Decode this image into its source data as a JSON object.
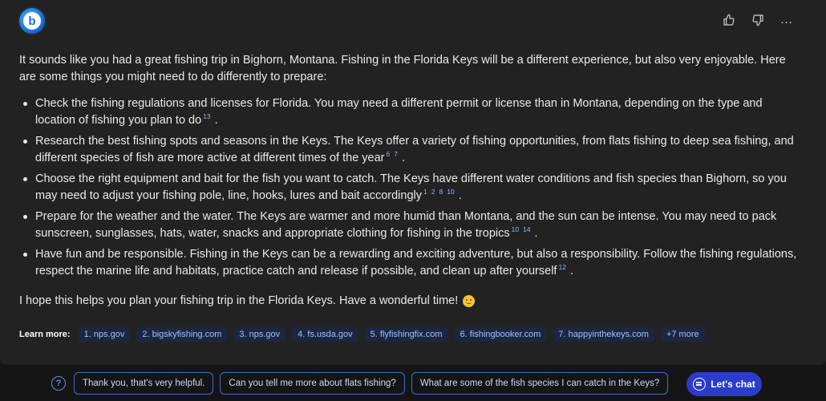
{
  "header": {
    "logo_letter": "b",
    "actions": [
      "thumbs-up-icon",
      "thumbs-down-icon",
      "more-icon"
    ],
    "more_label": "…"
  },
  "message": {
    "intro": "It sounds like you had a great fishing trip in Bighorn, Montana. Fishing in the Florida Keys will be a different experience, but also very enjoyable. Here are some things you might need to do differently to prepare:",
    "points": [
      {
        "text": "Check the fishing regulations and licenses for Florida. You may need a different permit or license than in Montana, depending on the type and location of fishing you plan to do",
        "citations": [
          "13"
        ]
      },
      {
        "text": "Research the best fishing spots and seasons in the Keys. The Keys offer a variety of fishing opportunities, from flats fishing to deep sea fishing, and different species of fish are more active at different times of the year",
        "citations": [
          "6",
          "7"
        ]
      },
      {
        "text": "Choose the right equipment and bait for the fish you want to catch. The Keys have different water conditions and fish species than Bighorn, so you may need to adjust your fishing pole, line, hooks, lures and bait accordingly",
        "citations": [
          "1",
          "2",
          "8",
          "10"
        ]
      },
      {
        "text": "Prepare for the weather and the water. The Keys are warmer and more humid than Montana, and the sun can be intense. You may need to pack sunscreen, sunglasses, hats, water, snacks and appropriate clothing for fishing in the tropics",
        "citations": [
          "10",
          "14"
        ]
      },
      {
        "text": "Have fun and be responsible. Fishing in the Keys can be a rewarding and exciting adventure, but also a responsibility. Follow the fishing regulations, respect the marine life and habitats, practice catch and release if possible, and clean up after yourself",
        "citations": [
          "12"
        ]
      }
    ],
    "outro": "I hope this helps you plan your fishing trip in the Florida Keys. Have a wonderful time!"
  },
  "learn_more": {
    "label": "Learn more:",
    "links": [
      "1. nps.gov",
      "2. bigskyfishing.com",
      "3. nps.gov",
      "4. fs.usda.gov",
      "5. flyfishingfix.com",
      "6. fishingbooker.com",
      "7. happyinthekeys.com",
      "+7 more"
    ]
  },
  "suggestions": {
    "help_label": "?",
    "items": [
      "Thank you, that's very helpful.",
      "Can you tell me more about flats fishing?",
      "What are some of the fish species I can catch in the Keys?"
    ],
    "chat_button": "Let's chat"
  }
}
